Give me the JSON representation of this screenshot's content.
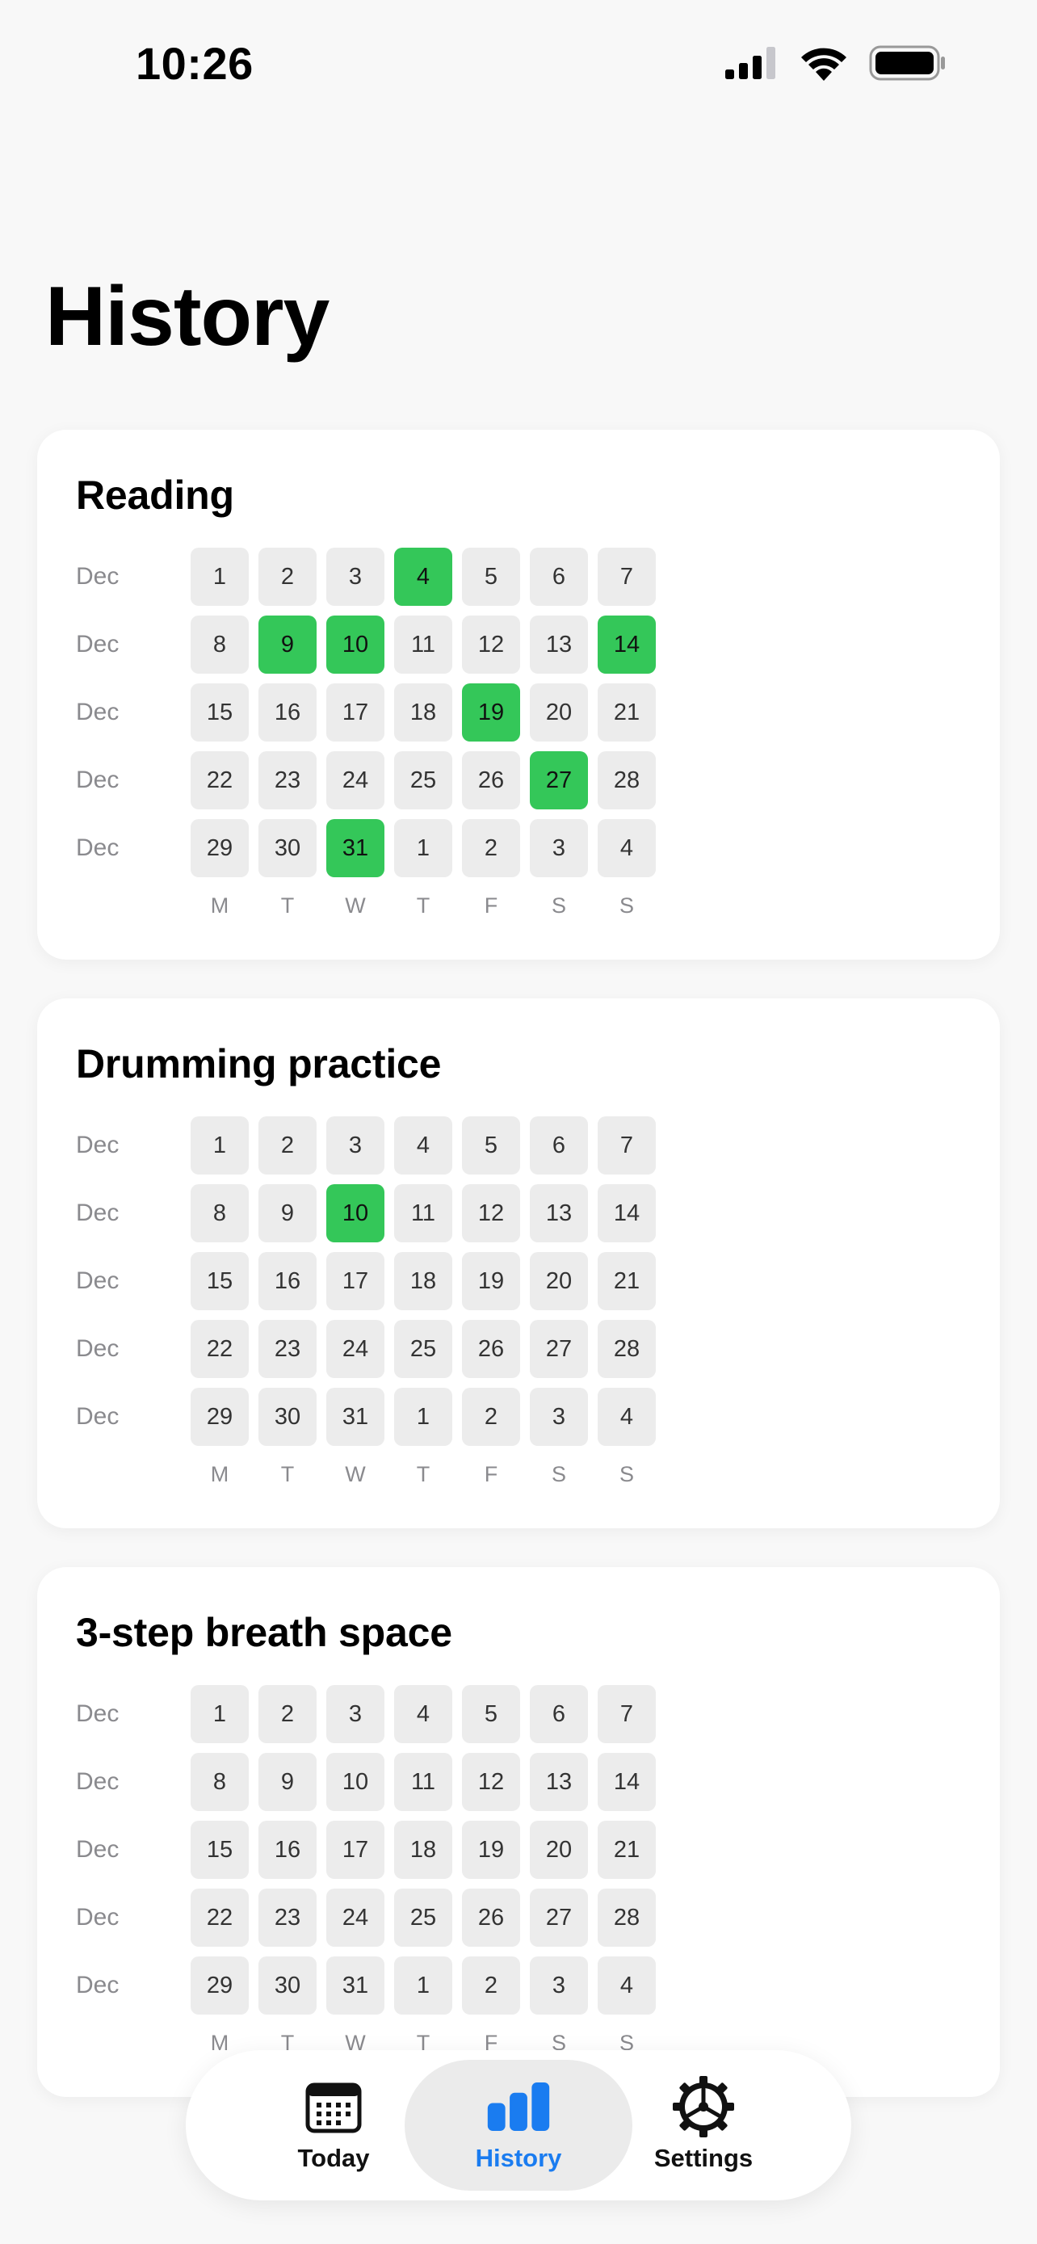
{
  "status_bar": {
    "time": "10:26"
  },
  "page": {
    "title": "History"
  },
  "weekdays": [
    "M",
    "T",
    "W",
    "T",
    "F",
    "S",
    "S"
  ],
  "colors": {
    "done": "#34c759",
    "empty": "#ececec",
    "accent": "#1a7cf0"
  },
  "cards": [
    {
      "title": "Reading",
      "rows": [
        {
          "month": "Dec",
          "days": [
            "1",
            "2",
            "3",
            "4",
            "5",
            "6",
            "7"
          ],
          "done": [
            false,
            false,
            false,
            true,
            false,
            false,
            false
          ]
        },
        {
          "month": "Dec",
          "days": [
            "8",
            "9",
            "10",
            "11",
            "12",
            "13",
            "14"
          ],
          "done": [
            false,
            true,
            true,
            false,
            false,
            false,
            true
          ]
        },
        {
          "month": "Dec",
          "days": [
            "15",
            "16",
            "17",
            "18",
            "19",
            "20",
            "21"
          ],
          "done": [
            false,
            false,
            false,
            false,
            true,
            false,
            false
          ]
        },
        {
          "month": "Dec",
          "days": [
            "22",
            "23",
            "24",
            "25",
            "26",
            "27",
            "28"
          ],
          "done": [
            false,
            false,
            false,
            false,
            false,
            true,
            false
          ]
        },
        {
          "month": "Dec",
          "days": [
            "29",
            "30",
            "31",
            "1",
            "2",
            "3",
            "4"
          ],
          "done": [
            false,
            false,
            true,
            false,
            false,
            false,
            false
          ]
        }
      ]
    },
    {
      "title": "Drumming practice",
      "rows": [
        {
          "month": "Dec",
          "days": [
            "1",
            "2",
            "3",
            "4",
            "5",
            "6",
            "7"
          ],
          "done": [
            false,
            false,
            false,
            false,
            false,
            false,
            false
          ]
        },
        {
          "month": "Dec",
          "days": [
            "8",
            "9",
            "10",
            "11",
            "12",
            "13",
            "14"
          ],
          "done": [
            false,
            false,
            true,
            false,
            false,
            false,
            false
          ]
        },
        {
          "month": "Dec",
          "days": [
            "15",
            "16",
            "17",
            "18",
            "19",
            "20",
            "21"
          ],
          "done": [
            false,
            false,
            false,
            false,
            false,
            false,
            false
          ]
        },
        {
          "month": "Dec",
          "days": [
            "22",
            "23",
            "24",
            "25",
            "26",
            "27",
            "28"
          ],
          "done": [
            false,
            false,
            false,
            false,
            false,
            false,
            false
          ]
        },
        {
          "month": "Dec",
          "days": [
            "29",
            "30",
            "31",
            "1",
            "2",
            "3",
            "4"
          ],
          "done": [
            false,
            false,
            false,
            false,
            false,
            false,
            false
          ]
        }
      ]
    },
    {
      "title": "3-step breath space",
      "rows": [
        {
          "month": "Dec",
          "days": [
            "1",
            "2",
            "3",
            "4",
            "5",
            "6",
            "7"
          ],
          "done": [
            false,
            false,
            false,
            false,
            false,
            false,
            false
          ]
        },
        {
          "month": "Dec",
          "days": [
            "8",
            "9",
            "10",
            "11",
            "12",
            "13",
            "14"
          ],
          "done": [
            false,
            false,
            false,
            false,
            false,
            false,
            false
          ]
        },
        {
          "month": "Dec",
          "days": [
            "15",
            "16",
            "17",
            "18",
            "19",
            "20",
            "21"
          ],
          "done": [
            false,
            false,
            false,
            false,
            false,
            false,
            false
          ]
        },
        {
          "month": "Dec",
          "days": [
            "22",
            "23",
            "24",
            "25",
            "26",
            "27",
            "28"
          ],
          "done": [
            false,
            false,
            false,
            false,
            false,
            false,
            false
          ]
        },
        {
          "month": "Dec",
          "days": [
            "29",
            "30",
            "31",
            "1",
            "2",
            "3",
            "4"
          ],
          "done": [
            false,
            false,
            false,
            false,
            false,
            false,
            false
          ]
        }
      ]
    }
  ],
  "tab_bar": {
    "tabs": [
      {
        "label": "Today",
        "icon": "calendar-icon",
        "active": false
      },
      {
        "label": "History",
        "icon": "bar-chart-icon",
        "active": true
      },
      {
        "label": "Settings",
        "icon": "gear-icon",
        "active": false
      }
    ]
  }
}
